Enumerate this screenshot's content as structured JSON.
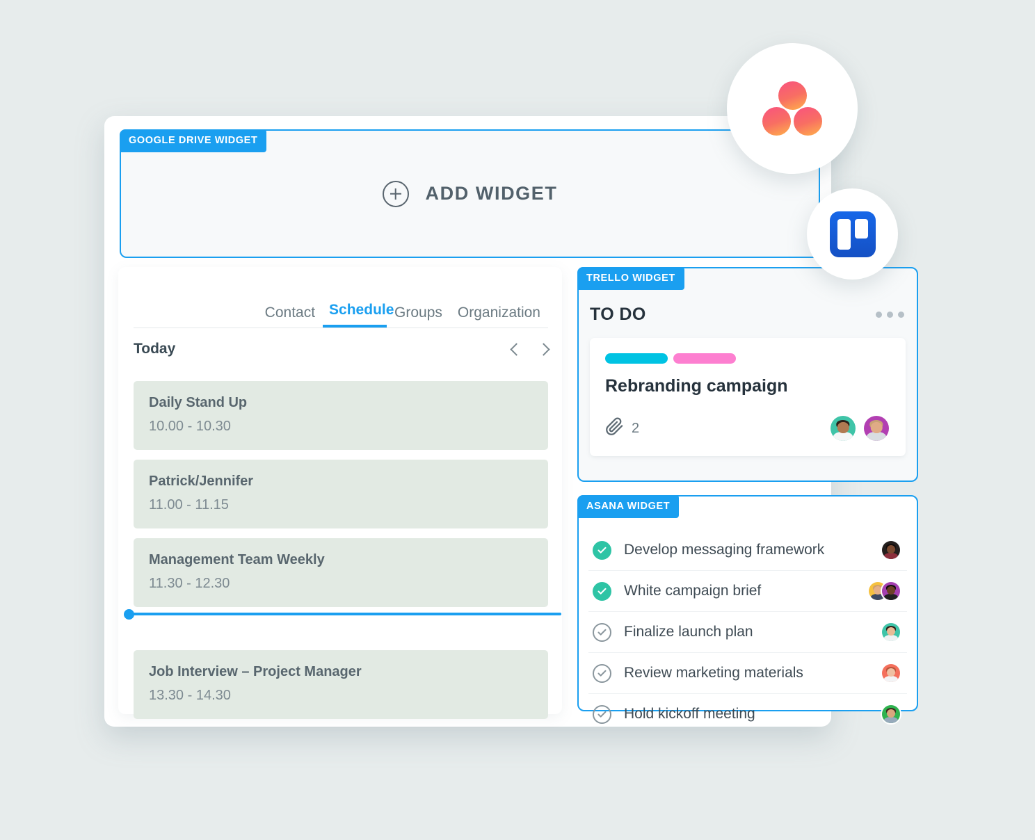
{
  "page": {
    "background_color": "#e7ecec",
    "accent_color": "#1a9ff0"
  },
  "gdrive_widget": {
    "tag": "GOOGLE DRIVE WIDGET",
    "add_label": "ADD WIDGET",
    "plus_icon": "plus-circle-icon"
  },
  "schedule": {
    "tabs": [
      {
        "label": "Contact",
        "active": false
      },
      {
        "label": "Schedule",
        "active": true
      },
      {
        "label": "Groups",
        "active": false
      },
      {
        "label": "Organization",
        "active": false
      }
    ],
    "header": "Today",
    "prev_icon": "chevron-left-icon",
    "next_icon": "chevron-right-icon",
    "events": [
      {
        "title": "Daily Stand Up",
        "time": "10.00 - 10.30"
      },
      {
        "title": "Patrick/Jennifer",
        "time": "11.00 - 11.15"
      },
      {
        "title": "Management Team Weekly",
        "time": "11.30 - 12.30"
      },
      {
        "title": "Job Interview – Project Manager",
        "time": "13.30 - 14.30"
      }
    ],
    "event_bg_color": "#e2eae3",
    "current_time_indicator_color": "#1a9ff0"
  },
  "trello": {
    "tag": "TRELLO WIDGET",
    "list_title": "TO DO",
    "menu_icon": "more-horizontal-icon",
    "card": {
      "labels": [
        {
          "name": "cyan-label",
          "color": "#00c3e3"
        },
        {
          "name": "pink-label",
          "color": "#fd7fd0"
        }
      ],
      "title": "Rebranding campaign",
      "attachment_icon": "paperclip-icon",
      "attachment_count": "2",
      "members": [
        {
          "name": "member-avatar-1",
          "bg": "#3fc4a8",
          "skin": "#b07a52",
          "hair": "#2b2119",
          "shirt": "#f4f6f7"
        },
        {
          "name": "member-avatar-2",
          "bg": "#b23fb2",
          "skin": "#e0ab86",
          "hair": "#c9a274",
          "shirt": "#d9dde1"
        }
      ]
    }
  },
  "asana": {
    "tag": "ASANA WIDGET",
    "tasks": [
      {
        "name": "Develop messaging framework",
        "done": true,
        "assignees": [
          {
            "name": "assignee-avatar-1",
            "bg": "#241f1d",
            "skin": "#7c4a30",
            "hair": "#120d0b",
            "shirt": "#8d2f3c"
          }
        ]
      },
      {
        "name": "White campaign brief",
        "done": true,
        "assignees": [
          {
            "name": "assignee-avatar-2",
            "bg": "#f6c13f",
            "skin": "#e6b088",
            "hair": "#cfa06a",
            "shirt": "#3e4a63"
          },
          {
            "name": "assignee-avatar-3",
            "bg": "#a43fb0",
            "skin": "#6d4027",
            "hair": "#120d0b",
            "shirt": "#21201f"
          }
        ]
      },
      {
        "name": "Finalize launch plan",
        "done": false,
        "assignees": [
          {
            "name": "assignee-avatar-4",
            "bg": "#3fc4a8",
            "skin": "#e9bb96",
            "hair": "#2e2119",
            "shirt": "#f0f2f3"
          }
        ]
      },
      {
        "name": "Review marketing materials",
        "done": false,
        "assignees": [
          {
            "name": "assignee-avatar-5",
            "bg": "#f4705c",
            "skin": "#efc0a2",
            "hair": "#b9563c",
            "shirt": "#f3f4f5"
          }
        ]
      },
      {
        "name": "Hold kickoff meeting",
        "done": false,
        "assignees": [
          {
            "name": "assignee-avatar-6",
            "bg": "#2fb24f",
            "skin": "#d9a67e",
            "hair": "#3c2a1e",
            "shirt": "#97aabb"
          }
        ]
      }
    ],
    "check_done_color": "#2ec4a5"
  },
  "brand_circles": [
    {
      "name": "asana-logo",
      "logo": "asana-three-dots-logo"
    },
    {
      "name": "trello-logo",
      "logo": "trello-board-logo"
    }
  ]
}
